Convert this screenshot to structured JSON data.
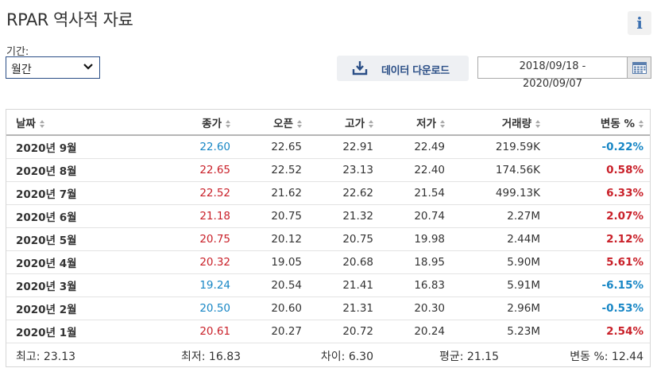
{
  "page": {
    "title": "RPAR 역사적 자료",
    "info_icon_glyph": "i"
  },
  "controls": {
    "period_label": "기간:",
    "period_value": "월간",
    "download_label": "데이터 다운로드",
    "date_line1": "2018/09/18 -",
    "date_line2": "2020/09/07"
  },
  "colors": {
    "up": "#c92029",
    "down": "#1786c5",
    "accent": "#2a4e86"
  },
  "table": {
    "headers": {
      "date": "날짜",
      "close": "종가",
      "open": "오픈",
      "high": "고가",
      "low": "저가",
      "volume": "거래량",
      "change": "변동 %"
    },
    "rows": [
      {
        "date": "2020년 9월",
        "close": "22.60",
        "open": "22.65",
        "high": "22.91",
        "low": "22.49",
        "volume": "219.59K",
        "change": "-0.22%",
        "dir": "down"
      },
      {
        "date": "2020년 8월",
        "close": "22.65",
        "open": "22.52",
        "high": "23.13",
        "low": "22.40",
        "volume": "174.56K",
        "change": "0.58%",
        "dir": "up"
      },
      {
        "date": "2020년 7월",
        "close": "22.52",
        "open": "21.62",
        "high": "22.62",
        "low": "21.54",
        "volume": "499.13K",
        "change": "6.33%",
        "dir": "up"
      },
      {
        "date": "2020년 6월",
        "close": "21.18",
        "open": "20.75",
        "high": "21.32",
        "low": "20.74",
        "volume": "2.27M",
        "change": "2.07%",
        "dir": "up"
      },
      {
        "date": "2020년 5월",
        "close": "20.75",
        "open": "20.12",
        "high": "20.75",
        "low": "19.98",
        "volume": "2.44M",
        "change": "2.12%",
        "dir": "up"
      },
      {
        "date": "2020년 4월",
        "close": "20.32",
        "open": "19.05",
        "high": "20.68",
        "low": "18.95",
        "volume": "5.90M",
        "change": "5.61%",
        "dir": "up"
      },
      {
        "date": "2020년 3월",
        "close": "19.24",
        "open": "20.54",
        "high": "21.41",
        "low": "16.83",
        "volume": "5.91M",
        "change": "-6.15%",
        "dir": "down"
      },
      {
        "date": "2020년 2월",
        "close": "20.50",
        "open": "20.60",
        "high": "21.31",
        "low": "20.30",
        "volume": "2.96M",
        "change": "-0.53%",
        "dir": "down"
      },
      {
        "date": "2020년 1월",
        "close": "20.61",
        "open": "20.27",
        "high": "20.72",
        "low": "20.24",
        "volume": "5.23M",
        "change": "2.54%",
        "dir": "up"
      }
    ],
    "summary": {
      "highest": "최고: 23.13",
      "lowest": "최저: 16.83",
      "difference": "차이: 6.30",
      "average": "평균: 21.15",
      "change": "변동 %: 12.44"
    }
  }
}
